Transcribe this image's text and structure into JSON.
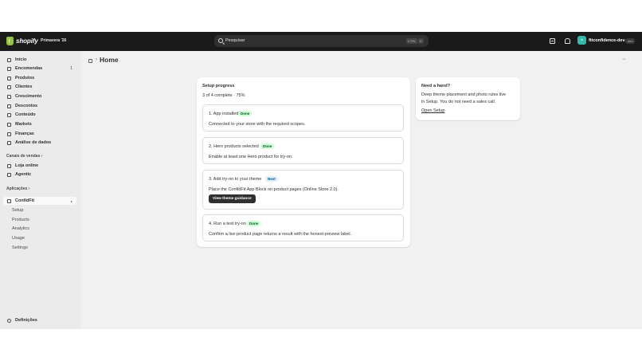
{
  "topbar": {
    "logo_text": "shopify",
    "edition": "Primavera '26",
    "search_placeholder": "Pesquisar",
    "shortcut_ctrl": "CTRL",
    "shortcut_key": "K",
    "avatar_initials": "fd",
    "store_name": "fitconfidence-dev",
    "store_badge": "dev"
  },
  "sidebar": {
    "items": [
      {
        "label": "Início",
        "icon": "home-icon"
      },
      {
        "label": "Encomendas",
        "icon": "inbox-icon",
        "count": "1"
      },
      {
        "label": "Produtos",
        "icon": "tag-icon"
      },
      {
        "label": "Clientes",
        "icon": "person-icon"
      },
      {
        "label": "Crescimento",
        "icon": "target-icon"
      },
      {
        "label": "Descontos",
        "icon": "discount-icon"
      },
      {
        "label": "Conteúdo",
        "icon": "image-icon"
      },
      {
        "label": "Markets",
        "icon": "globe-icon"
      },
      {
        "label": "Finanças",
        "icon": "bank-icon"
      },
      {
        "label": "Análise de dados",
        "icon": "chart-icon"
      }
    ],
    "sales_channels_heading": "Canais de vendas",
    "sales_channels": [
      {
        "label": "Loja online",
        "icon": "store-icon"
      },
      {
        "label": "Agentic",
        "icon": "sparkle-icon"
      }
    ],
    "apps_heading": "Aplicações",
    "app": {
      "label": "ConfidFit",
      "sub_items": [
        "Setup",
        "Products",
        "Analytics",
        "Usage",
        "Settings"
      ]
    },
    "settings_label": "Definições"
  },
  "page": {
    "title": "Home",
    "more_label": "···"
  },
  "setup_card": {
    "title": "Setup progress",
    "progress": "3 of 4 complete · 75%",
    "steps": [
      {
        "title": "1. App installed",
        "badge": "Done",
        "desc": "Connected to your store with the required scopes."
      },
      {
        "title": "2. Hero products selected",
        "badge": "Done",
        "desc": "Enable at least one Hero product for try-on."
      },
      {
        "title": "3. Add try-on to your theme",
        "badge": "Next",
        "desc": "Place the ConfidFit App Block on product pages (Online Store 2.0).",
        "button": "View theme guidance"
      },
      {
        "title": "4. Run a test try-on",
        "badge": "Done",
        "desc": "Confirm a live product page returns a result with the honest preview label."
      }
    ]
  },
  "help_card": {
    "title": "Need a hand?",
    "line1": "Deep theme placement and photo rules live",
    "line2": "in Setup. You do not need a sales call.",
    "link": "Open Setup"
  },
  "colors": {
    "topbar": "#1a1a1a",
    "sidebar": "#ebebeb",
    "main": "#f1f1f1",
    "done_badge": "#cdfed4",
    "next_badge": "#e0f0ff",
    "brand": "#95bf47"
  }
}
